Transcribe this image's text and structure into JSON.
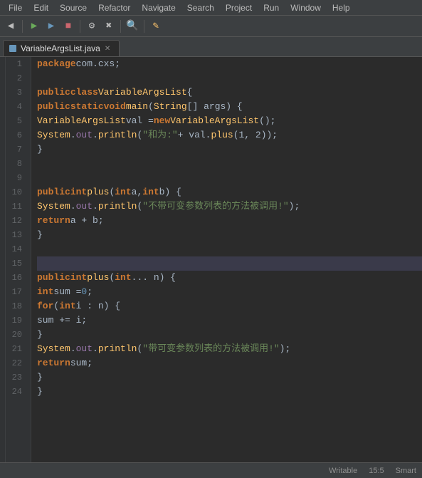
{
  "menu": {
    "items": [
      "File",
      "Edit",
      "Source",
      "Refactor",
      "Navigate",
      "Search",
      "Project",
      "Run",
      "Window",
      "Help"
    ]
  },
  "tab": {
    "label": "VariableArgsList.java",
    "icon": "java-file-icon"
  },
  "status": {
    "context": "Writable",
    "position": "15:5",
    "encoding": "Smart"
  },
  "lines": [
    {
      "num": 1,
      "tokens": [
        {
          "t": "kw",
          "v": "package"
        },
        {
          "t": "plain",
          "v": " com.cxs;"
        }
      ]
    },
    {
      "num": 2,
      "tokens": []
    },
    {
      "num": 3,
      "tokens": [
        {
          "t": "kw",
          "v": "public"
        },
        {
          "t": "plain",
          "v": " "
        },
        {
          "t": "kw",
          "v": "class"
        },
        {
          "t": "plain",
          "v": " "
        },
        {
          "t": "cls",
          "v": "VariableArgsList"
        },
        {
          "t": "plain",
          "v": " {"
        }
      ]
    },
    {
      "num": 4,
      "tokens": [
        {
          "t": "plain",
          "v": "    "
        },
        {
          "t": "kw",
          "v": "public"
        },
        {
          "t": "plain",
          "v": " "
        },
        {
          "t": "kw",
          "v": "static"
        },
        {
          "t": "plain",
          "v": " "
        },
        {
          "t": "kw",
          "v": "void"
        },
        {
          "t": "plain",
          "v": " "
        },
        {
          "t": "method",
          "v": "main"
        },
        {
          "t": "plain",
          "v": "("
        },
        {
          "t": "cls",
          "v": "String"
        },
        {
          "t": "plain",
          "v": "[] args) {"
        }
      ]
    },
    {
      "num": 5,
      "tokens": [
        {
          "t": "plain",
          "v": "        "
        },
        {
          "t": "cls",
          "v": "VariableArgsList"
        },
        {
          "t": "plain",
          "v": " val = "
        },
        {
          "t": "kw",
          "v": "new"
        },
        {
          "t": "plain",
          "v": " "
        },
        {
          "t": "cls",
          "v": "VariableArgsList"
        },
        {
          "t": "plain",
          "v": "();"
        }
      ]
    },
    {
      "num": 6,
      "tokens": [
        {
          "t": "plain",
          "v": "        "
        },
        {
          "t": "cls",
          "v": "System"
        },
        {
          "t": "plain",
          "v": "."
        },
        {
          "t": "field",
          "v": "out"
        },
        {
          "t": "plain",
          "v": "."
        },
        {
          "t": "method",
          "v": "println"
        },
        {
          "t": "plain",
          "v": "("
        },
        {
          "t": "str",
          "v": "\"和为:\""
        },
        {
          "t": "plain",
          "v": " + val."
        },
        {
          "t": "method",
          "v": "plus"
        },
        {
          "t": "plain",
          "v": "(1, 2));"
        }
      ]
    },
    {
      "num": 7,
      "tokens": [
        {
          "t": "plain",
          "v": "    }"
        }
      ]
    },
    {
      "num": 8,
      "tokens": []
    },
    {
      "num": 9,
      "tokens": []
    },
    {
      "num": 10,
      "tokens": [
        {
          "t": "plain",
          "v": "    "
        },
        {
          "t": "kw",
          "v": "public"
        },
        {
          "t": "plain",
          "v": " "
        },
        {
          "t": "kw",
          "v": "int"
        },
        {
          "t": "plain",
          "v": " "
        },
        {
          "t": "method",
          "v": "plus"
        },
        {
          "t": "plain",
          "v": "("
        },
        {
          "t": "kw",
          "v": "int"
        },
        {
          "t": "plain",
          "v": " a, "
        },
        {
          "t": "kw",
          "v": "int"
        },
        {
          "t": "plain",
          "v": " b) {"
        }
      ],
      "hasBreakpoint": false,
      "hasArrow": false
    },
    {
      "num": 11,
      "tokens": [
        {
          "t": "plain",
          "v": "        "
        },
        {
          "t": "cls",
          "v": "System"
        },
        {
          "t": "plain",
          "v": "."
        },
        {
          "t": "field",
          "v": "out"
        },
        {
          "t": "plain",
          "v": "."
        },
        {
          "t": "method",
          "v": "println"
        },
        {
          "t": "plain",
          "v": "("
        },
        {
          "t": "str",
          "v": "\"不带可变参数列表的方法被调用!\""
        },
        {
          "t": "plain",
          "v": ");"
        }
      ]
    },
    {
      "num": 12,
      "tokens": [
        {
          "t": "plain",
          "v": "        "
        },
        {
          "t": "kw",
          "v": "return"
        },
        {
          "t": "plain",
          "v": " a + b;"
        }
      ]
    },
    {
      "num": 13,
      "tokens": [
        {
          "t": "plain",
          "v": "    }"
        }
      ]
    },
    {
      "num": 14,
      "tokens": []
    },
    {
      "num": 15,
      "tokens": [],
      "highlighted": true
    },
    {
      "num": 16,
      "tokens": [
        {
          "t": "plain",
          "v": "    "
        },
        {
          "t": "kw",
          "v": "public"
        },
        {
          "t": "plain",
          "v": " "
        },
        {
          "t": "kw",
          "v": "int"
        },
        {
          "t": "plain",
          "v": " "
        },
        {
          "t": "method",
          "v": "plus"
        },
        {
          "t": "plain",
          "v": "("
        },
        {
          "t": "kw",
          "v": "int"
        },
        {
          "t": "plain",
          "v": "... n) {"
        }
      ]
    },
    {
      "num": 17,
      "tokens": [
        {
          "t": "plain",
          "v": "        "
        },
        {
          "t": "kw",
          "v": "int"
        },
        {
          "t": "plain",
          "v": " sum = "
        },
        {
          "t": "num",
          "v": "0"
        },
        {
          "t": "plain",
          "v": ";"
        }
      ]
    },
    {
      "num": 18,
      "tokens": [
        {
          "t": "plain",
          "v": "        "
        },
        {
          "t": "kw",
          "v": "for"
        },
        {
          "t": "plain",
          "v": " ("
        },
        {
          "t": "kw",
          "v": "int"
        },
        {
          "t": "plain",
          "v": " i : n) {"
        }
      ]
    },
    {
      "num": 19,
      "tokens": [
        {
          "t": "plain",
          "v": "            sum += i;"
        }
      ]
    },
    {
      "num": 20,
      "tokens": [
        {
          "t": "plain",
          "v": "        }"
        }
      ]
    },
    {
      "num": 21,
      "tokens": [
        {
          "t": "plain",
          "v": "        "
        },
        {
          "t": "cls",
          "v": "System"
        },
        {
          "t": "plain",
          "v": "."
        },
        {
          "t": "field",
          "v": "out"
        },
        {
          "t": "plain",
          "v": "."
        },
        {
          "t": "method",
          "v": "println"
        },
        {
          "t": "plain",
          "v": "("
        },
        {
          "t": "str",
          "v": "\"带可变参数列表的方法被调用!\""
        },
        {
          "t": "plain",
          "v": ");"
        }
      ]
    },
    {
      "num": 22,
      "tokens": [
        {
          "t": "plain",
          "v": "        "
        },
        {
          "t": "kw",
          "v": "return"
        },
        {
          "t": "plain",
          "v": " sum;"
        }
      ]
    },
    {
      "num": 23,
      "tokens": [
        {
          "t": "plain",
          "v": "    }"
        }
      ]
    },
    {
      "num": 24,
      "tokens": [
        {
          "t": "plain",
          "v": "}"
        }
      ]
    }
  ]
}
